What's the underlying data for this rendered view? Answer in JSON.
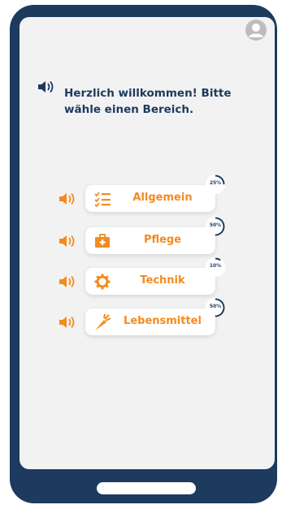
{
  "welcome": {
    "text": "Herzlich willkommen! Bitte wähle einen Bereich."
  },
  "colors": {
    "accent": "#f38b1f",
    "navy": "#1d3a5f",
    "screen": "#f2f2f2"
  },
  "categories": [
    {
      "label": "Allgemein",
      "progress": "25%",
      "icon": "checklist-icon",
      "progress_value": 25
    },
    {
      "label": "Pflege",
      "progress": "50%",
      "icon": "first-aid-kit-icon",
      "progress_value": 50
    },
    {
      "label": "Technik",
      "progress": "10%",
      "icon": "gear-icon",
      "progress_value": 10
    },
    {
      "label": "Lebensmittel",
      "progress": "50%",
      "icon": "carrot-icon",
      "progress_value": 50
    }
  ]
}
